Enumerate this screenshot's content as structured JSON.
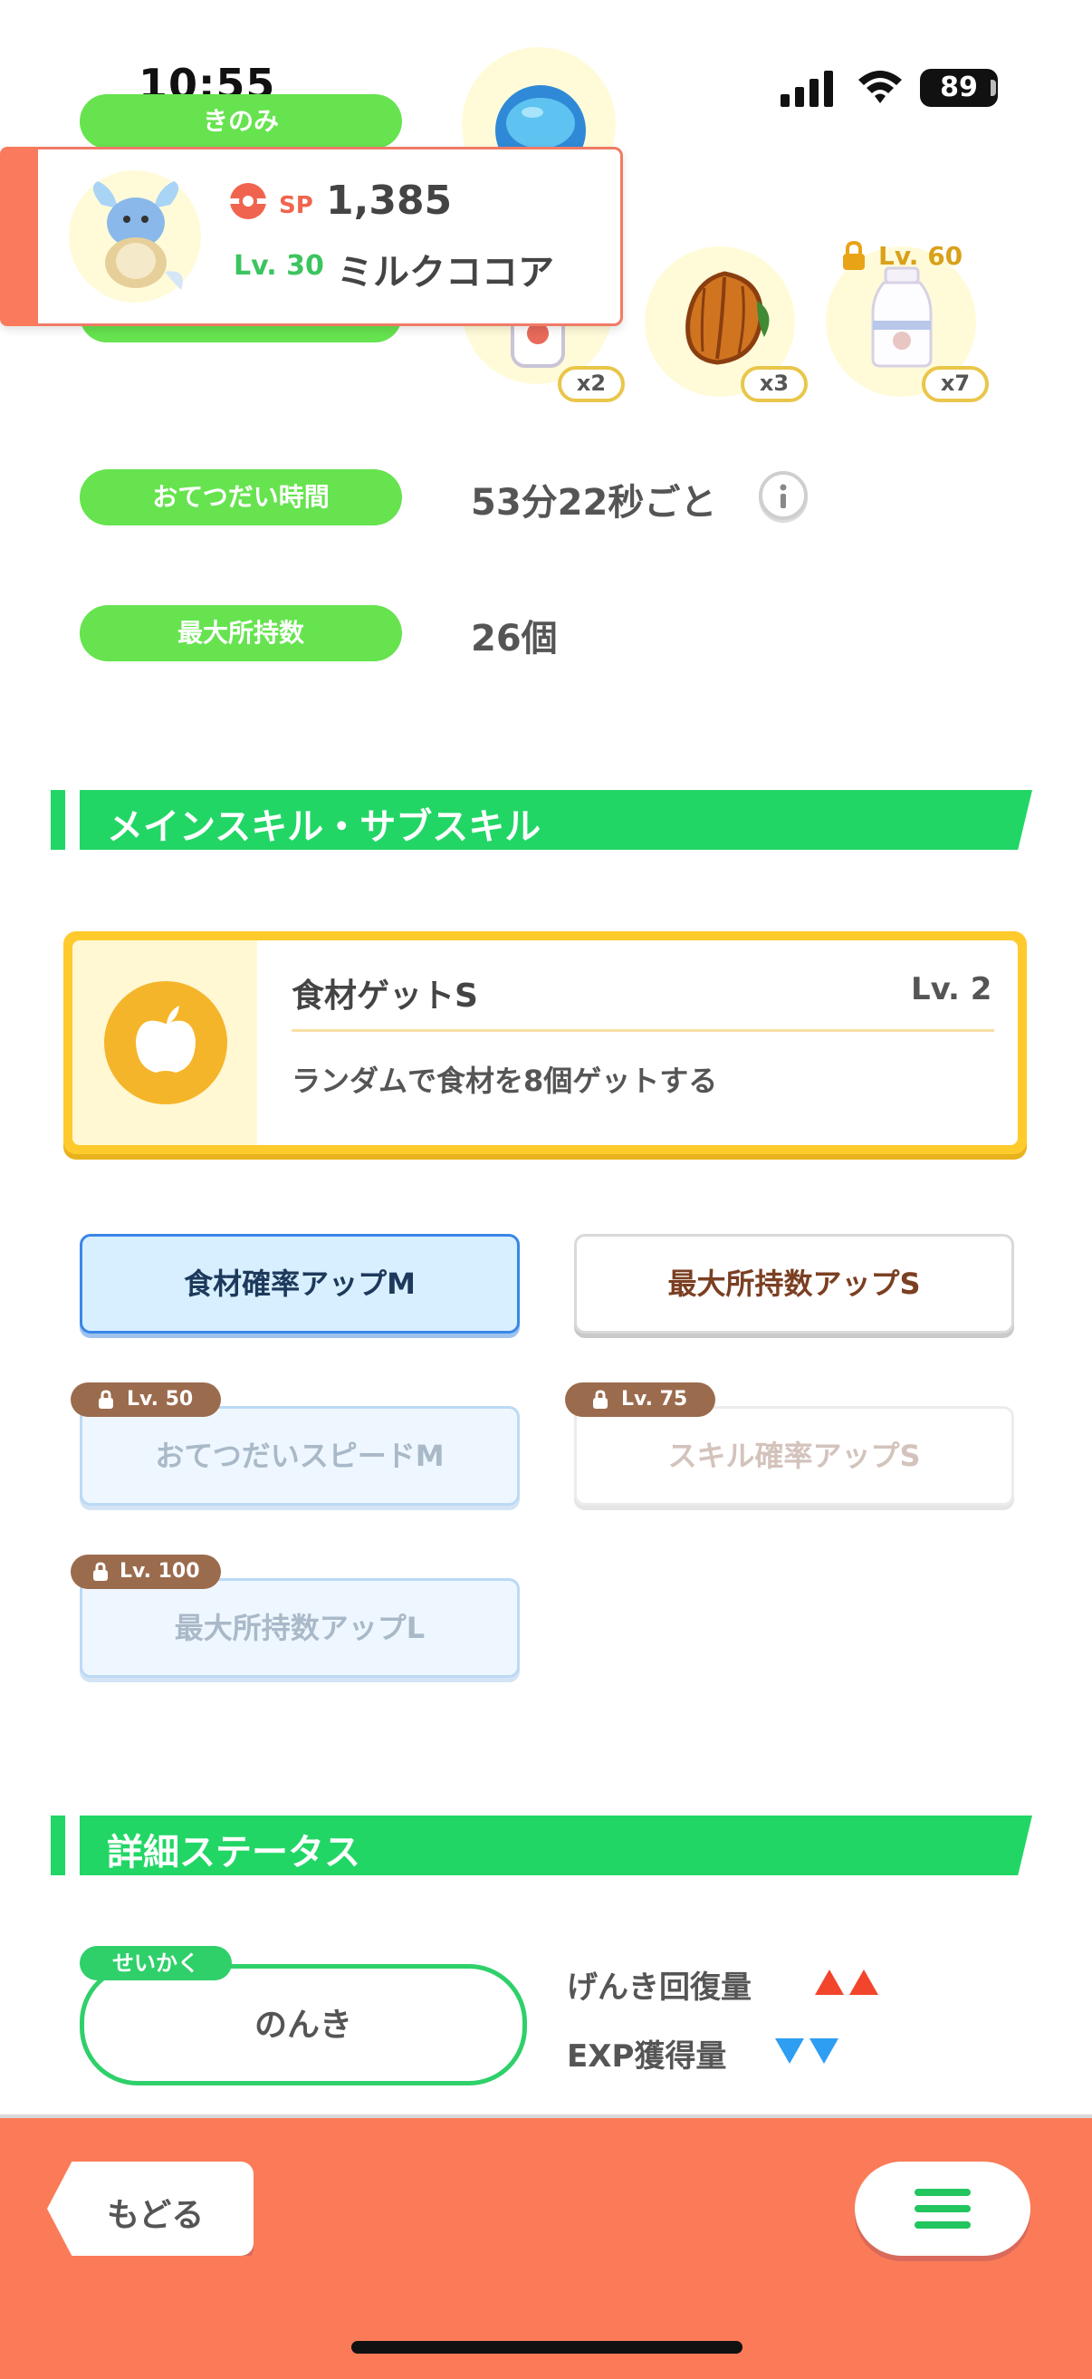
{
  "status_bar": {
    "time": "10:55",
    "battery": "89"
  },
  "berry_section": {
    "label": "きのみ"
  },
  "pokemon_card": {
    "sp_label": "SP",
    "sp_value": "1,385",
    "level": "Lv. 30",
    "name": "ミルクココア"
  },
  "ingredients": [
    {
      "qty": "x2"
    },
    {
      "qty": "x3"
    },
    {
      "qty": "x7",
      "lock_level": "Lv. 60"
    }
  ],
  "help_time": {
    "label": "おてつだい時間",
    "value": "53分22秒ごと"
  },
  "max_carry": {
    "label": "最大所持数",
    "value": "26個"
  },
  "skills_section": {
    "title": "メインスキル・サブスキル"
  },
  "main_skill": {
    "name": "食材ゲットS",
    "level": "Lv. 2",
    "description": "ランダムで食材を8個ゲットする"
  },
  "sub_skills": [
    {
      "label": "食材確率アップM",
      "lock": ""
    },
    {
      "label": "最大所持数アップS",
      "lock": ""
    },
    {
      "label": "おてつだいスピードM",
      "lock": "Lv. 50"
    },
    {
      "label": "スキル確率アップS",
      "lock": "Lv. 75"
    },
    {
      "label": "最大所持数アップL",
      "lock": "Lv. 100"
    }
  ],
  "detail_section": {
    "title": "詳細ステータス"
  },
  "nature": {
    "tag": "せいかく",
    "value": "のんき",
    "up_label": "げんき回復量",
    "down_label": "EXP獲得量",
    "colors": {
      "up": "#f2452c",
      "down": "#2e9ef2"
    }
  },
  "bottom_bar": {
    "back_label": "もどる"
  },
  "colors": {
    "accent_green": "#22d666",
    "pill_green": "#66e34f",
    "bottom_orange": "#fb7b58"
  }
}
